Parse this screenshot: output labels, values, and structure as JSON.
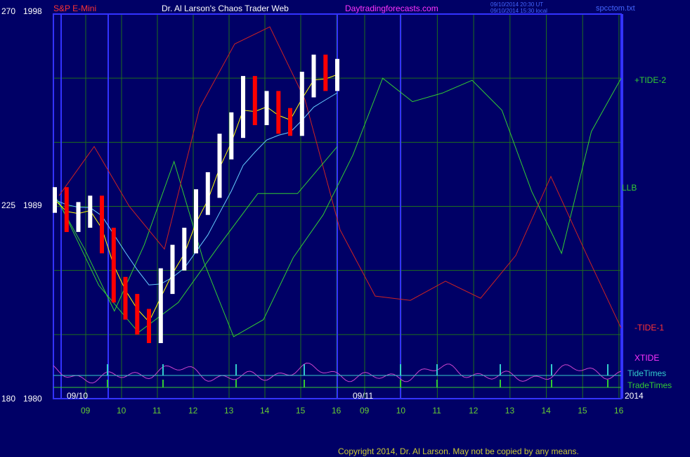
{
  "header": {
    "symbol": "S&P E-Mini",
    "title": "Dr. Al Larson's Chaos Trader Web",
    "site": "Daytradingforecasts.com",
    "timestamp_ut": "09/10/2014 20:30 UT",
    "timestamp_local": "09/10/2014 15:30 local",
    "file": "spcctom.txt"
  },
  "footer": {
    "copyright": "Copyright 2014, Dr. Al Larson. May not be copied by any means."
  },
  "colors": {
    "background": "#000066",
    "grid": "#1e6e1e",
    "border": "#3333ff",
    "tide_plus": "#33cc33",
    "tide_minus": "#cc2222",
    "xtide": "#cc44cc",
    "tide_times": "#33cccc",
    "trade_times": "#33cc33",
    "up_bar": "#ffffff",
    "down_bar": "#ff0000",
    "ema_fast": "#ffff00",
    "ema_slow": "#66ccff",
    "axis_text": "#ffffff",
    "hour_labels": "#66cc33"
  },
  "chart_data": {
    "type": "line",
    "title": "S&P E-Mini",
    "y_labels": [
      {
        "tick": "270",
        "price": "1998"
      },
      {
        "tick": "225",
        "price": "1989"
      },
      {
        "tick": "180",
        "price": "1980"
      }
    ],
    "ylim": [
      1980,
      1998
    ],
    "x_hours": [
      "09",
      "10",
      "11",
      "12",
      "13",
      "14",
      "15",
      "16",
      "09",
      "10",
      "11",
      "12",
      "13",
      "14",
      "15",
      "16"
    ],
    "date_labels": [
      "09/10",
      "09/11",
      "2014"
    ],
    "series_labels": {
      "tide_plus": "+TIDE-2",
      "llb": "LLB",
      "tide_minus": "-TIDE-1",
      "xtide": "XTIDE",
      "tide_times": "TideTimes",
      "trade_times": "TradeTimes"
    },
    "price_close_sample": [
      1989.3,
      1988.4,
      1988.6,
      1988.9,
      1987.4,
      1985.1,
      1984.3,
      1983.6,
      1983.2,
      1985.5,
      1986.6,
      1987.4,
      1989.2,
      1990.0,
      1991.8,
      1992.8,
      1994.5,
      1993.4,
      1993.8,
      1993.0,
      1992.9,
      1994.7,
      1995.5,
      1995.0,
      1995.3
    ],
    "tide_plus_2": [
      1989.5,
      1987.0,
      1984.1,
      1987.2,
      1991.1,
      1986.4,
      1982.9,
      1983.7,
      1986.6,
      1988.6,
      1991.4,
      1995.0,
      1993.9,
      1994.3,
      1994.9,
      1993.5,
      1989.7,
      1986.8,
      1992.5,
      1995.0
    ],
    "tide_minus_1": [
      1989.5,
      1991.8,
      1989.0,
      1987.0,
      1993.6,
      1996.6,
      1997.4,
      1994.0,
      1987.9,
      1984.8,
      1984.6,
      1985.5,
      1984.7,
      1986.7,
      1990.4,
      1986.8,
      1983.3
    ],
    "llb_series": [
      1989.2,
      1985.3,
      1983.1,
      1984.5,
      1987.1,
      1989.6,
      1989.6,
      1991.8
    ]
  }
}
